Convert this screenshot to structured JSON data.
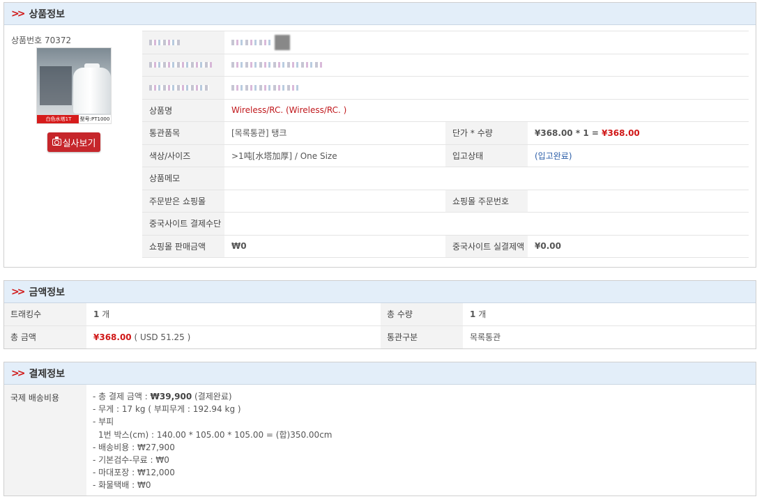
{
  "product": {
    "section_title": "상품정보",
    "product_number": "상품번호 70372",
    "photo_button": "실사보기",
    "image_label_left": "白色水塔1T",
    "image_label_right": "型号:PT1000",
    "rows": [
      {
        "label": "상품명",
        "value": "Wireless/RC. (Wireless/RC. )"
      },
      {
        "label": "통관품목",
        "value": "[목록통관] 탱크",
        "label2": "단가 * 수량",
        "unit_price": "¥368.00",
        "times": "*",
        "qty": "1",
        "eq": "=",
        "total": "¥368.00"
      },
      {
        "label": "색상/사이즈",
        "value": ">1吨[水塔加厚] / One Size",
        "label2": "입고상태",
        "value2": "(입고완료)"
      },
      {
        "label": "상품메모",
        "value": ""
      },
      {
        "label": "주문받은 쇼핑몰",
        "value": "",
        "label2": "쇼핑몰 주문번호",
        "value2": ""
      },
      {
        "label": "중국사이트 결제수단",
        "value": ""
      },
      {
        "label": "쇼핑몰 판매금액",
        "value": "₩0",
        "label2": "중국사이트 실결제액",
        "value2": "¥0.00"
      }
    ]
  },
  "amount": {
    "section_title": "금액정보",
    "tracking_label": "트래킹수",
    "tracking_value": "1",
    "tracking_unit": "개",
    "total_qty_label": "총 수량",
    "total_qty_value": "1",
    "total_qty_unit": "개",
    "total_amount_label": "총 금액",
    "total_amount_value": "¥368.00",
    "total_amount_usd": "( USD 51.25 )",
    "customs_label": "통관구분",
    "customs_value": "목록통관"
  },
  "payment": {
    "section_title": "결제정보",
    "label": "국제 배송비용",
    "line1_prefix": "- 총 결제 금액 : ",
    "line1_amount": "₩39,900",
    "line1_suffix": " (결제완료)",
    "line2": "- 무게 : 17 kg ( 부피무게 : 192.94 kg )",
    "line3": "- 부피",
    "line4": "1번 박스(cm) : 140.00 * 105.00 * 105.00 = (합)350.00cm",
    "line5": "- 배송비용 : ₩27,900",
    "line6": "- 기본검수-무료 : ₩0",
    "line7": "- 마대포장 : ₩12,000",
    "line8": "- 화물택배 : ₩0"
  },
  "colors": {
    "accent_red": "#d01818",
    "header_bg": "#e3eef9",
    "label_bg": "#f3f3f3",
    "link_blue": "#2c5ea8"
  },
  "icons": [
    "double-chevron-right-icon",
    "camera-icon"
  ]
}
